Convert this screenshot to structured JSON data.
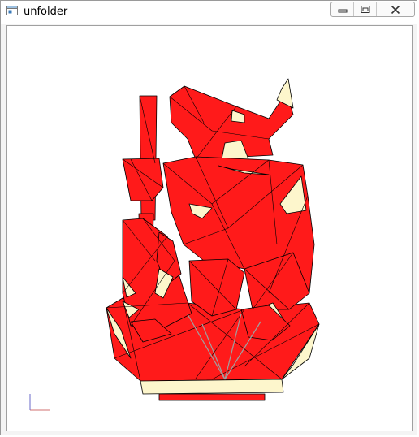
{
  "window": {
    "title": "unfolder",
    "icons": {
      "app": "app-window-icon",
      "minimize": "minimize-icon",
      "maximize": "maximize-icon",
      "close": "close-icon"
    }
  },
  "viewport": {
    "content": "3d-mesh-model",
    "colors": {
      "face_front": "#ff1a1a",
      "face_back": "#fdf6cc",
      "edge": "#000000",
      "fold_line": "#a0a0a0",
      "axis_x": "#d07070",
      "axis_y": "#6a6ac8"
    }
  }
}
